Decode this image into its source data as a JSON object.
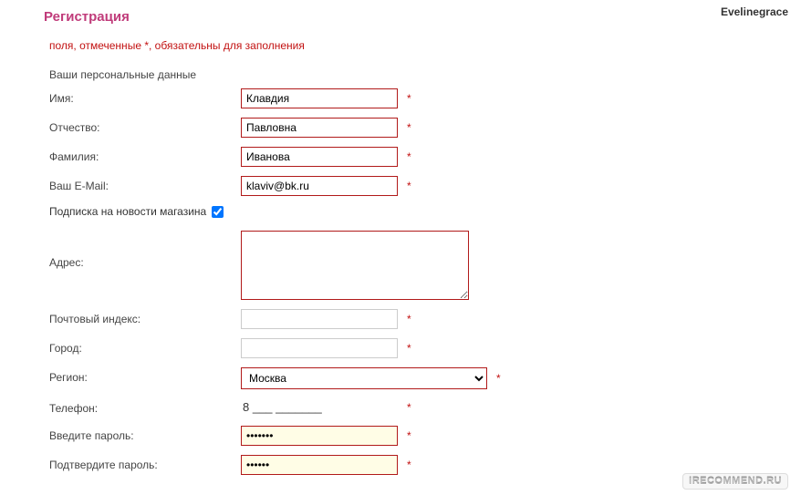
{
  "watermark": {
    "user": "Evelinegrace",
    "site": "IRECOMMEND.RU"
  },
  "header": {
    "title": "Регистрация",
    "required_note": "поля, отмеченные *, обязательны для заполнения",
    "section_title": "Ваши персональные данные"
  },
  "fields": {
    "first_name": {
      "label": "Имя:",
      "value": "Клавдия"
    },
    "patronymic": {
      "label": "Отчество:",
      "value": "Павловна"
    },
    "last_name": {
      "label": "Фамилия:",
      "value": "Иванова"
    },
    "email": {
      "label": "Ваш E-Mail:",
      "value": "klaviv@bk.ru"
    },
    "subscribe": {
      "label": "Подписка на новости магазина"
    },
    "address": {
      "label": "Адрес:",
      "value": ""
    },
    "postal": {
      "label": "Почтовый индекс:",
      "value": ""
    },
    "city": {
      "label": "Город:",
      "value": ""
    },
    "region": {
      "label": "Регион:",
      "value": "Москва"
    },
    "phone": {
      "label": "Телефон:",
      "value": "8 ___ _______"
    },
    "password": {
      "label": "Введите пароль:",
      "value": "•••••••"
    },
    "password_confirm": {
      "label": "Подтвердите пароль:",
      "value": "••••••"
    }
  },
  "asterisk": "*"
}
